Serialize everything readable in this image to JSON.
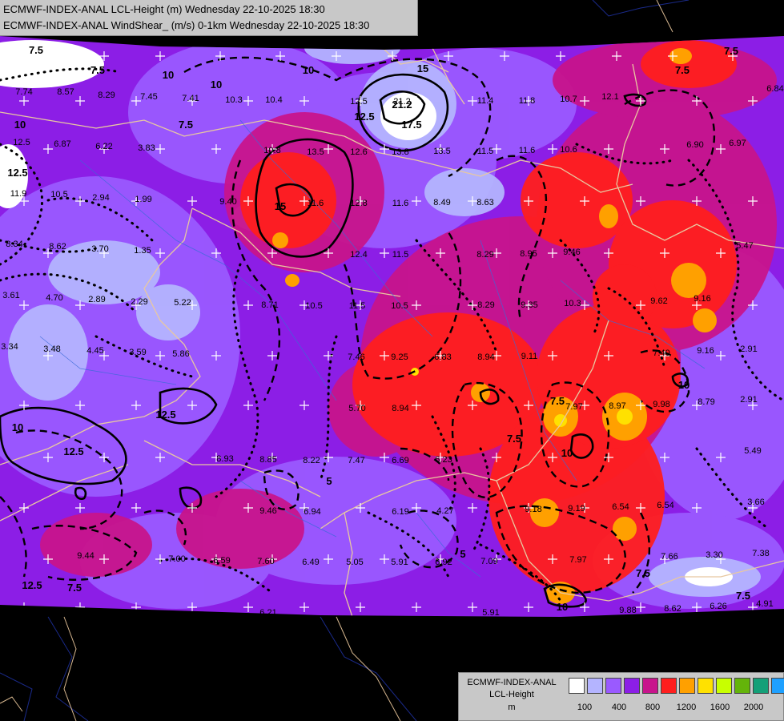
{
  "header": {
    "line1": "ECMWF-INDEX-ANAL LCL-Height (m) Wednesday 22-10-2025 18:30",
    "line2": "ECMWF-INDEX-ANAL WindShear_ (m/s) 0-1km Wednesday 22-10-2025 18:30"
  },
  "legend": {
    "title1": "ECMWF-INDEX-ANAL",
    "title2": "LCL-Height",
    "unit": "m",
    "colors": [
      "#ffffff",
      "#b4b4ff",
      "#9a5aff",
      "#8c1ee6",
      "#c8148c",
      "#ff1e1e",
      "#ffa000",
      "#ffe100",
      "#c8ff00",
      "#64b40a",
      "#14a078",
      "#1ea0ff"
    ],
    "ticks": [
      "100",
      "400",
      "800",
      "1200",
      "1600",
      "2000"
    ]
  },
  "contour_labels": [
    "7.5",
    "7.5",
    "10",
    "10",
    "12.5",
    "15",
    "17.5",
    "21.2",
    "15",
    "12.5",
    "10",
    "7.5",
    "10",
    "7.5",
    "7.5",
    "12.5",
    "10",
    "10",
    "7.5",
    "7.5",
    "5",
    "12.5",
    "10",
    "7.5",
    "7.5",
    "5",
    "7.5",
    "10",
    "12.5"
  ],
  "station_values": [
    "7.74",
    "8.57",
    "8.29",
    "7.45",
    "7.41",
    "10.3",
    "10.4",
    "12.5",
    "21.2",
    "11.4",
    "11.8",
    "10.7",
    "12.1",
    "6.84",
    "12.5",
    "6.87",
    "6.22",
    "3.83",
    "10.8",
    "13.5",
    "12.6",
    "13.8",
    "13.5",
    "11.5",
    "11.6",
    "10.6",
    "6.90",
    "6.97",
    "11.9",
    "10.5",
    "2.94",
    "1.99",
    "9.40",
    "11.6",
    "12.8",
    "11.6",
    "8.49",
    "8.63",
    "8.34",
    "8.62",
    "3.70",
    "1.35",
    "12.4",
    "11.5",
    "8.29",
    "8.95",
    "9.46",
    "5.47",
    "3.61",
    "4.70",
    "2.89",
    "2.29",
    "5.22",
    "8.71",
    "10.5",
    "11.5",
    "10.5",
    "8.29",
    "9.35",
    "10.3",
    "9.62",
    "9.16",
    "3.34",
    "3.48",
    "4.45",
    "3.59",
    "5.86",
    "7.46",
    "9.25",
    "6.83",
    "8.94",
    "9.11",
    "7.40",
    "9.16",
    "2.91",
    "2.91",
    "5.70",
    "8.94",
    "7.97",
    "8.97",
    "9.98",
    "8.79",
    "8.93",
    "8.85",
    "8.22",
    "7.47",
    "6.69",
    "6.23",
    "6.54",
    "3.66",
    "5.49",
    "9.46",
    "6.94",
    "6.19",
    "4.27",
    "9.18",
    "9.19",
    "6.54",
    "3.30",
    "7.38",
    "9.44",
    "7.00",
    "6.59",
    "7.60",
    "6.49",
    "5.05",
    "5.91",
    "6.92",
    "7.09",
    "7.97",
    "7.66",
    "9.88",
    "8.62",
    "6.26",
    "6.21",
    "5.91",
    "4.91"
  ]
}
